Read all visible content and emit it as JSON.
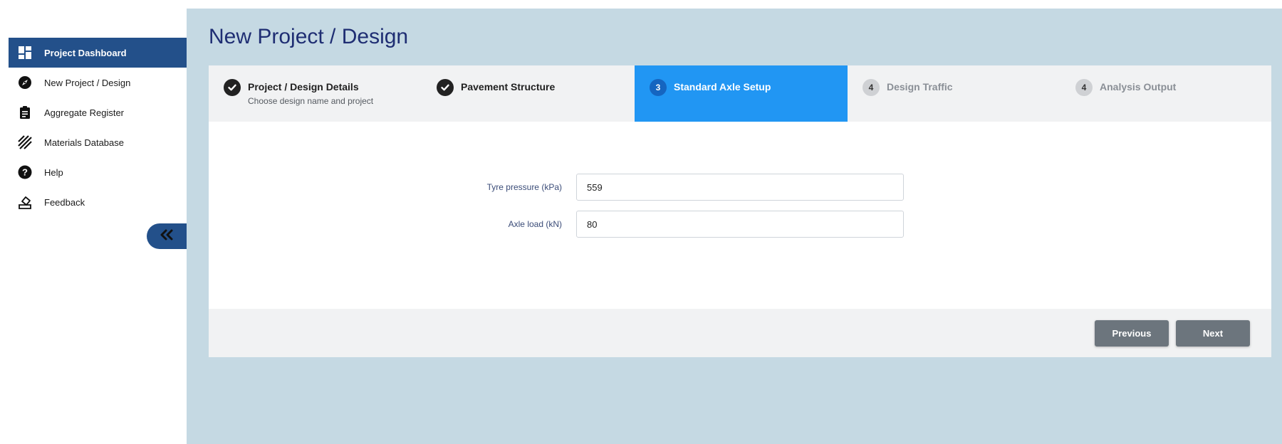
{
  "sidebar": {
    "items": [
      {
        "label": "Project Dashboard",
        "icon": "dashboard-icon",
        "active": true
      },
      {
        "label": "New Project / Design",
        "icon": "compass-icon"
      },
      {
        "label": "Aggregate Register",
        "icon": "clipboard-icon"
      },
      {
        "label": "Materials Database",
        "icon": "hatch-icon"
      },
      {
        "label": "Help",
        "icon": "help-icon"
      },
      {
        "label": "Feedback",
        "icon": "feedback-icon"
      }
    ],
    "collapse_icon": "double-chevron-left-icon"
  },
  "main": {
    "title": "New Project / Design",
    "steps": [
      {
        "marker": "",
        "title": "Project / Design Details",
        "subtitle": "Choose design name and project",
        "state": "done"
      },
      {
        "marker": "",
        "title": "Pavement Structure",
        "subtitle": "",
        "state": "done"
      },
      {
        "marker": "3",
        "title": "Standard Axle Setup",
        "subtitle": "",
        "state": "active"
      },
      {
        "marker": "4",
        "title": "Design Traffic",
        "subtitle": "",
        "state": "pending"
      },
      {
        "marker": "4",
        "title": "Analysis Output",
        "subtitle": "",
        "state": "pending"
      }
    ],
    "form": {
      "tyre_pressure": {
        "label": "Tyre pressure (kPa)",
        "value": "559"
      },
      "axle_load": {
        "label": "Axle load (kN)",
        "value": "80"
      }
    },
    "buttons": {
      "previous": "Previous",
      "next": "Next"
    }
  },
  "colors": {
    "nav_active": "#23508a",
    "step_active": "#2196f3",
    "main_bg": "#c5d9e3",
    "title": "#1f2e73",
    "button": "#6c757d"
  }
}
